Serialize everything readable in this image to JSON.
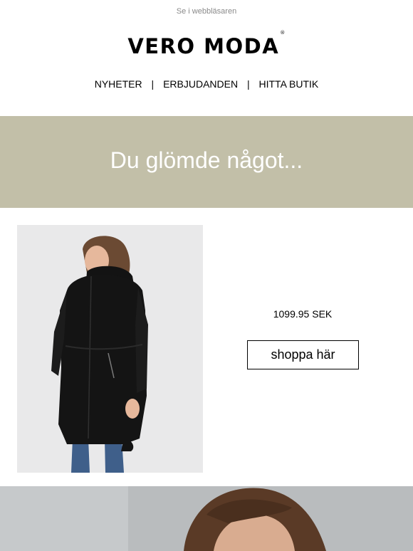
{
  "header": {
    "browser_link": "Se i webbläsaren",
    "logo_text": "VERO MODA",
    "logo_mark": "®"
  },
  "nav": {
    "items": [
      {
        "label": "NYHETER"
      },
      {
        "label": "ERBJUDANDEN"
      },
      {
        "label": "HITTA BUTIK"
      }
    ],
    "separator": "|"
  },
  "banner": {
    "title": "Du glömde något...",
    "background": "#c2bfa8"
  },
  "product": {
    "image_icon": "black-parka-coat-photo",
    "price": "1099.95 SEK",
    "button_label": "shoppa här"
  },
  "hero": {
    "image_icon": "woman-portrait-photo"
  }
}
